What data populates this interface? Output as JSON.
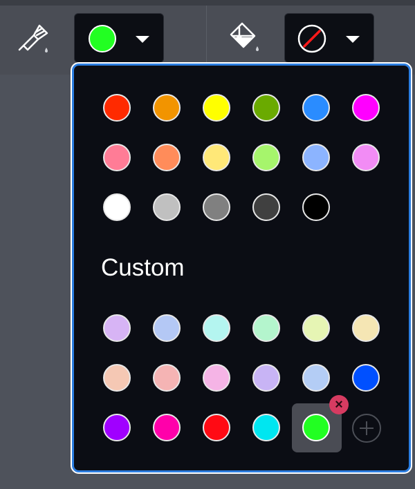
{
  "toolbar": {
    "stroke_tool": {
      "icon": "paintbrush-icon"
    },
    "stroke_color": {
      "color": "#22ff22",
      "dropdown_icon": "caret-down-icon"
    },
    "fill_tool": {
      "icon": "paint-bucket-icon"
    },
    "fill_color": {
      "value": "none",
      "icon": "no-color-icon",
      "dropdown_icon": "caret-down-icon"
    }
  },
  "palette": {
    "preset_colors": [
      [
        "#ff2a00",
        "#f29400",
        "#ffff00",
        "#6aaa00",
        "#2a8cff",
        "#ff00ff"
      ],
      [
        "#ff7c96",
        "#ff8c5a",
        "#ffe878",
        "#a6f56c",
        "#8cb4ff",
        "#f28cf5"
      ],
      [
        "#ffffff",
        "#c0c0c0",
        "#808080",
        "#404040",
        "#000000"
      ]
    ],
    "custom_heading": "Custom",
    "custom_colors": [
      [
        "#d7b4f5",
        "#b4c8f5",
        "#b4f5f0",
        "#b4f5cd",
        "#e6f5b4",
        "#f5e6b4"
      ],
      [
        "#f5c8b4",
        "#f5b4b4",
        "#f5b4e6",
        "#c8b4f5",
        "#b4cdf5",
        "#0050ff"
      ],
      [
        "#a000ff",
        "#ff00aa",
        "#ff0a14",
        "#00e6f0",
        "#22ff22"
      ]
    ],
    "selected_color": "#22ff22",
    "remove_icon": "close-icon",
    "add_icon": "plus-icon"
  }
}
